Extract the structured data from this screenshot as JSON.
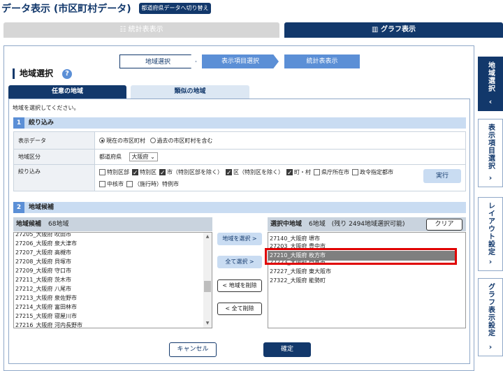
{
  "header": {
    "title": "データ表示 (市区町村データ)",
    "switch_label": "都道府県データへ切り替え"
  },
  "top_tabs": [
    {
      "icon": "list-icon",
      "label": "統計表表示"
    },
    {
      "icon": "bar-chart-icon",
      "label": "グラフ表示"
    }
  ],
  "steps": [
    "地域選択",
    "表示項目選択",
    "統計表表示"
  ],
  "section_title": "地域選択",
  "sub_tabs": [
    "任意の地域",
    "類似の地域"
  ],
  "instruction": "地域を選択してください。",
  "filter": {
    "num": "1",
    "title": "絞り込み",
    "display_label": "表示データ",
    "display_opt1": "現在の市区町村",
    "display_opt2": "過去の市区町村を含む",
    "area_label": "地域区分",
    "pref_label": "都道府県",
    "pref_value": "大阪府",
    "narrow_label": "絞り込み",
    "opts": [
      {
        "label": "特別区部",
        "checked": false
      },
      {
        "label": "特別区",
        "checked": true
      },
      {
        "label": "市（特別区部を除く）",
        "checked": true
      },
      {
        "label": "区（特別区を除く）",
        "checked": true
      },
      {
        "label": "町・村",
        "checked": true
      },
      {
        "label": "県庁所在市",
        "checked": false
      },
      {
        "label": "政令指定都市",
        "checked": false
      },
      {
        "label": "中核市",
        "checked": false
      },
      {
        "label": "（施行時）特例市",
        "checked": false
      }
    ],
    "run_label": "実行"
  },
  "candidates": {
    "num": "2",
    "title": "地域候補",
    "list_title": "地域候補",
    "count": "68地域",
    "items": [
      "27205_大阪府 吹田市",
      "27206_大阪府 泉大津市",
      "27207_大阪府 高槻市",
      "27208_大阪府 貝塚市",
      "27209_大阪府 守口市",
      "27211_大阪府 茨木市",
      "27212_大阪府 八尾市",
      "27213_大阪府 泉佐野市",
      "27214_大阪府 富田林市",
      "27215_大阪府 寝屋川市",
      "27216_大阪府 河内長野市"
    ]
  },
  "middle_buttons": {
    "add": "地域を選択 >",
    "add_all": "全て選択 >",
    "remove": "< 地域を削除",
    "remove_all": "< 全て削除"
  },
  "selected": {
    "title": "選択中地域",
    "count": "6地域　(残り 2494地域選択可能)",
    "clear_label": "クリア",
    "items": [
      "27140_大阪府 堺市",
      "27203_大阪府 豊中市",
      "27210_大阪府 枚方市",
      "27223_大阪府 門真市",
      "27227_大阪府 東大阪市",
      "27322_大阪府 能勢町"
    ],
    "selected_index": 2
  },
  "bottom": {
    "cancel": "キャンセル",
    "confirm": "確定"
  },
  "side_nav": [
    {
      "label": "地域選択",
      "chevron": "‹"
    },
    {
      "label": "表示項目選択",
      "chevron": "›"
    },
    {
      "label": "レイアウト設定",
      "chevron": "›"
    },
    {
      "label": "グラフ表示設定",
      "chevron": "›"
    }
  ]
}
